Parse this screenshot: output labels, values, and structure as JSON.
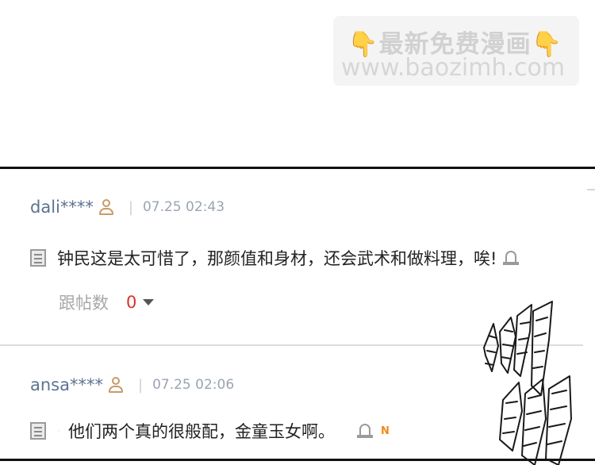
{
  "watermark": {
    "line1": "最新免费漫画",
    "hand_left": "👇",
    "hand_right": "👇",
    "line2": "www.baozimh.com"
  },
  "comments": [
    {
      "username": "dali****",
      "separator": "|",
      "timestamp": "07.25 02:43",
      "text": "钟民这是太可惜了，那颜值和身材，还会武术和做料理，唉!",
      "reply_label": "跟帖数",
      "reply_count": "0"
    },
    {
      "username": "ansa****",
      "separator": "|",
      "timestamp": "07.25 02:06",
      "text": "他们两个真的很般配，金童玉女啊。",
      "badge": "N"
    }
  ],
  "colors": {
    "username": "#5b7391",
    "timestamp": "#9aa4b0",
    "reply_count": "#d9312b",
    "new_badge": "#f08a1c"
  }
}
